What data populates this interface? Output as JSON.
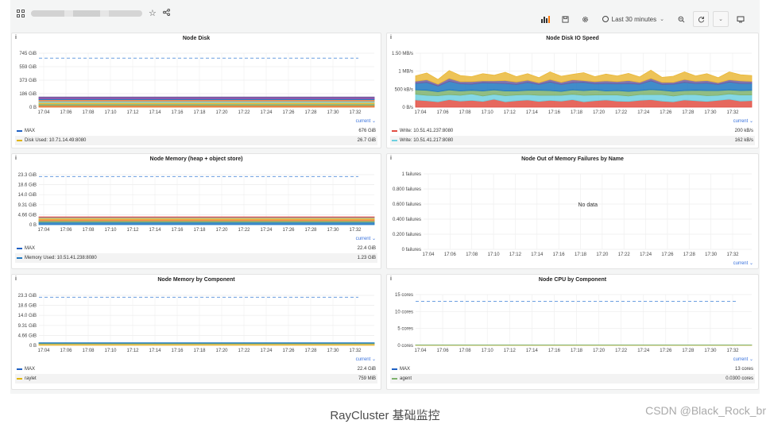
{
  "toolbar": {
    "time_range": "Last 30 minutes"
  },
  "panels": [
    {
      "title": "Node Disk",
      "info": "i",
      "chart_data": {
        "type": "area",
        "y_ticks": [
          "745 GiB",
          "559 GiB",
          "373 GiB",
          "186 GiB",
          "0 B"
        ],
        "ylim": [
          0,
          745
        ],
        "x_ticks": [
          "17:04",
          "17:06",
          "17:08",
          "17:10",
          "17:12",
          "17:14",
          "17:16",
          "17:18",
          "17:20",
          "17:22",
          "17:24",
          "17:26",
          "17:28",
          "17:30",
          "17:32"
        ],
        "max_line": 676,
        "stack": [
          {
            "color": "#e0752d",
            "values": [
              26.7
            ]
          },
          {
            "color": "#7eb26d",
            "values": [
              20
            ]
          },
          {
            "color": "#eab839",
            "values": [
              20
            ]
          },
          {
            "color": "#6ed0e0",
            "values": [
              18
            ]
          },
          {
            "color": "#ef843c",
            "values": [
              18
            ]
          },
          {
            "color": "#1f78c1",
            "values": [
              16
            ]
          },
          {
            "color": "#ba43a9",
            "values": [
              12
            ]
          },
          {
            "color": "#705da0",
            "values": [
              10
            ]
          }
        ]
      },
      "current_label": "current ⌄",
      "legend": [
        {
          "name": "MAX",
          "value": "676 GiB",
          "color": "#1f60c4"
        },
        {
          "name": "Disk Used: 10.71.14.49:8080",
          "value": "26.7 GiB",
          "color": "#e0b400"
        }
      ]
    },
    {
      "title": "Node Disk IO Speed",
      "info": "i",
      "chart_data": {
        "type": "area",
        "y_ticks": [
          "1.50 MB/s",
          "1 MB/s",
          "500 kB/s",
          "0 B/s"
        ],
        "ylim": [
          0,
          1500
        ],
        "x_ticks": [
          "17:04",
          "17:06",
          "17:08",
          "17:10",
          "17:12",
          "17:14",
          "17:16",
          "17:18",
          "17:20",
          "17:22",
          "17:24",
          "17:26",
          "17:28",
          "17:30",
          "17:32"
        ],
        "stack": [
          {
            "color": "#e24d42",
            "values": [
              200,
              180,
              150,
              210,
              170,
              190,
              160,
              220,
              150,
              180,
              200,
              160,
              190,
              170,
              210,
              150,
              180,
              200,
              170,
              160,
              190,
              210,
              170,
              150,
              200,
              180,
              160,
              190,
              220,
              170,
              180
            ]
          },
          {
            "color": "#6ed0e0",
            "values": [
              162,
              150,
              170,
              140,
              160,
              180,
              150,
              140,
              170,
              160,
              150,
              170,
              140,
              160,
              150,
              180,
              160,
              140,
              170,
              150,
              160,
              140,
              180,
              160,
              150,
              170,
              160,
              140,
              150,
              170,
              160
            ]
          },
          {
            "color": "#7eb26d",
            "values": [
              120,
              140,
              110,
              130,
              120,
              100,
              140,
              120,
              130,
              110,
              120,
              140,
              130,
              110,
              120,
              130,
              140,
              110,
              120,
              130,
              110,
              140,
              120,
              130,
              110,
              120,
              140,
              130,
              110,
              120,
              130
            ]
          },
          {
            "color": "#1f78c1",
            "values": [
              180,
              220,
              160,
              240,
              200,
              170,
              230,
              190,
              210,
              180,
              220,
              160,
              240,
              190,
              200,
              230,
              170,
              210,
              190,
              220,
              180,
              240,
              160,
              200,
              230,
              190,
              210,
              170,
              220,
              200,
              190
            ]
          },
          {
            "color": "#705da0",
            "values": [
              60,
              70,
              50,
              80,
              60,
              70,
              50,
              60,
              80,
              70,
              60,
              50,
              70,
              60,
              80,
              50,
              60,
              70,
              60,
              80,
              50,
              70,
              60,
              50,
              80,
              60,
              70,
              50,
              60,
              70,
              60
            ]
          },
          {
            "color": "#eab839",
            "values": [
              150,
              190,
              130,
              220,
              170,
              140,
              200,
              160,
              230,
              150,
              180,
              140,
              210,
              170,
              150,
              220,
              140,
              190,
              160,
              200,
              150,
              230,
              140,
              170,
              210,
              150,
              190,
              140,
              220,
              170,
              160
            ]
          }
        ]
      },
      "current_label": "current ⌄",
      "legend": [
        {
          "name": "Write: 10.51.41.237:8080",
          "value": "200 kB/s",
          "color": "#e24d42"
        },
        {
          "name": "Write: 10.51.41.217:8080",
          "value": "162 kB/s",
          "color": "#6ed0e0"
        }
      ]
    },
    {
      "title": "Node Memory (heap + object store)",
      "info": "i",
      "chart_data": {
        "type": "area",
        "y_ticks": [
          "23.3 GiB",
          "18.6 GiB",
          "14.0 GiB",
          "9.31 GiB",
          "4.66 GiB",
          "0 B"
        ],
        "ylim": [
          0,
          23.3
        ],
        "x_ticks": [
          "17:04",
          "17:06",
          "17:08",
          "17:10",
          "17:12",
          "17:14",
          "17:16",
          "17:18",
          "17:20",
          "17:22",
          "17:24",
          "17:26",
          "17:28",
          "17:30",
          "17:32"
        ],
        "max_line": 22.4,
        "stack": [
          {
            "color": "#1f78c1",
            "values": [
              1.23
            ]
          },
          {
            "color": "#7eb26d",
            "values": [
              0.6
            ]
          },
          {
            "color": "#ef843c",
            "values": [
              0.7
            ]
          },
          {
            "color": "#eab839",
            "values": [
              0.6
            ]
          },
          {
            "color": "#6ed0e0",
            "values": [
              0.3
            ]
          },
          {
            "color": "#e24d42",
            "values": [
              0.2
            ]
          }
        ]
      },
      "current_label": "current ⌄",
      "legend": [
        {
          "name": "MAX",
          "value": "22.4 GiB",
          "color": "#1f60c4"
        },
        {
          "name": "Memory Used: 10.51.41.238:8080",
          "value": "1.23 GiB",
          "color": "#1f78c1"
        }
      ]
    },
    {
      "title": "Node Out of Memory Failures by Name",
      "info": "i",
      "chart_data": {
        "type": "line",
        "y_ticks": [
          "1 failures",
          "0.800 failures",
          "0.600 failures",
          "0.400 failures",
          "0.200 failures",
          "0 failures"
        ],
        "ylim": [
          0,
          1
        ],
        "x_ticks": [
          "17:04",
          "17:06",
          "17:08",
          "17:10",
          "17:12",
          "17:14",
          "17:16",
          "17:18",
          "17:20",
          "17:22",
          "17:24",
          "17:26",
          "17:28",
          "17:30",
          "17:32"
        ],
        "stack": []
      },
      "nodata": "No data",
      "current_label": "current ⌄",
      "legend": []
    },
    {
      "title": "Node Memory by Component",
      "info": "i",
      "chart_data": {
        "type": "area",
        "y_ticks": [
          "23.3 GiB",
          "18.6 GiB",
          "14.0 GiB",
          "9.31 GiB",
          "4.66 GiB",
          "0 B"
        ],
        "ylim": [
          0,
          23.3
        ],
        "x_ticks": [
          "17:04",
          "17:06",
          "17:08",
          "17:10",
          "17:12",
          "17:14",
          "17:16",
          "17:18",
          "17:20",
          "17:22",
          "17:24",
          "17:26",
          "17:28",
          "17:30",
          "17:32"
        ],
        "max_line": 22.4,
        "stack": [
          {
            "color": "#eab839",
            "values": [
              0.74
            ]
          },
          {
            "color": "#7eb26d",
            "values": [
              0.3
            ]
          },
          {
            "color": "#1f78c1",
            "values": [
              0.2
            ]
          }
        ]
      },
      "current_label": "current ⌄",
      "legend": [
        {
          "name": "MAX",
          "value": "22.4 GiB",
          "color": "#1f60c4"
        },
        {
          "name": "raylet",
          "value": "759 MiB",
          "color": "#e0b400"
        }
      ]
    },
    {
      "title": "Node CPU by Component",
      "info": "i",
      "chart_data": {
        "type": "area",
        "y_ticks": [
          "15 cores",
          "10 cores",
          "5 cores",
          "0 cores"
        ],
        "ylim": [
          0,
          15
        ],
        "x_ticks": [
          "17:04",
          "17:06",
          "17:08",
          "17:10",
          "17:12",
          "17:14",
          "17:16",
          "17:18",
          "17:20",
          "17:22",
          "17:24",
          "17:26",
          "17:28",
          "17:30",
          "17:32"
        ],
        "max_line": 13,
        "stack": [
          {
            "color": "#eab839",
            "values": [
              0.1
            ]
          },
          {
            "color": "#7eb26d",
            "values": [
              0.03
            ]
          }
        ]
      },
      "current_label": "current ⌄",
      "legend": [
        {
          "name": "MAX",
          "value": "13 cores",
          "color": "#1f60c4"
        },
        {
          "name": "agent",
          "value": "0.0300 cores",
          "color": "#7eb26d"
        }
      ]
    }
  ],
  "caption": "RayCluster 基础监控",
  "watermark": "CSDN @Black_Rock_br"
}
